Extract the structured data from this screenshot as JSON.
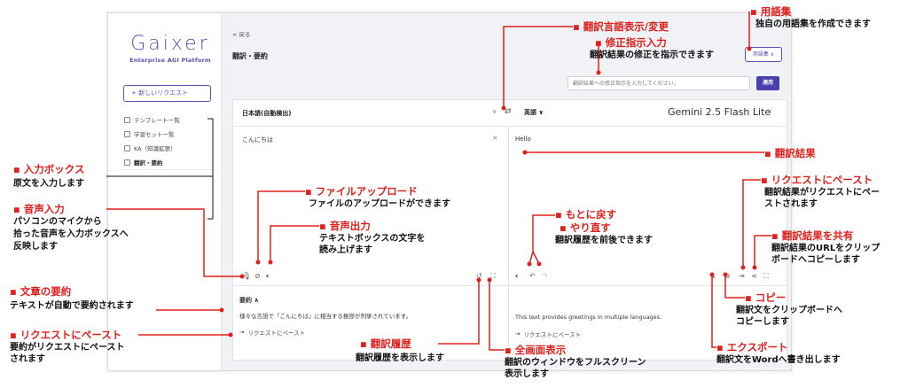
{
  "app": {
    "logo": "Gaixer",
    "logo_sub": "Enterprise AGI Platform",
    "new_request": "+ 新しいリクエスト",
    "nav": [
      "テンプレート一覧",
      "学習セット一覧",
      "KA（知識拡張）",
      "翻訳・要約"
    ],
    "back": "< 戻る",
    "page_title": "翻訳・要約",
    "glossary_button": "用語集 ∨",
    "instruction_placeholder": "翻訳結果への修正指示を入力してください。",
    "apply_button": "適用",
    "source_lang": "日本語(自動検出)",
    "target_lang": "英語 ∨",
    "model": "Gemini 2.5 Flash Lite",
    "source_text": "こんにちは",
    "target_text": "Hello",
    "summary_header": "要約 ∧",
    "summary_text": "様々な言語で「こんにちは」に相当する挨拶が列挙されています。",
    "summary_paste": "リクエストにペースト",
    "translated_summary_text": "This text provides greetings in multiple languages.",
    "translated_summary_paste": "リクエストにペースト"
  },
  "annotations": {
    "glossary_title": "▪ 用語集",
    "glossary_desc": "独自の用語集を作成できます",
    "lang_title": "▪ 翻訳言語表示/変更",
    "fix_title": "▪ 修正指示入力",
    "fix_desc": "翻訳結果の修正を指示できます",
    "result_title": "▪ 翻訳結果",
    "paste_req_title": "▪ リクエストにペースト",
    "paste_req_desc1": "翻訳結果がリクエストにペー",
    "paste_req_desc2": "ストされます",
    "share_title": "▪ 翻訳結果を共有",
    "share_desc1": "翻訳結果のURLをクリップ",
    "share_desc2": "ボードへコピーします",
    "copy_title": "▪ コピー",
    "copy_desc1": "翻訳文をクリップボードへ",
    "copy_desc2": "コピーします",
    "export_title": "▪ エクスポート",
    "export_desc": "翻訳文をWordへ書き出します",
    "fullscreen_title": "▪ 全画面表示",
    "fullscreen_desc1": "翻訳のウィンドウをフルスクリーン",
    "fullscreen_desc2": "表示します",
    "history_title": "▪ 翻訳履歴",
    "history_desc": "翻訳履歴を表示します",
    "undo_title": "▪ もとに戻す",
    "redo_title": "▪ やり直す",
    "undo_desc": "翻訳履歴を前後できます",
    "file_title": "▪ ファイルアップロード",
    "file_desc": "ファイルのアップロードができます",
    "speech_out_title": "▪ 音声出力",
    "speech_out_desc1": "テキストボックスの文字を",
    "speech_out_desc2": "読み上げます",
    "input_box_title": "▪ 入力ボックス",
    "input_box_desc": "原文を入力します",
    "voice_title": "▪ 音声入力",
    "voice_desc1": "パソコンのマイクから",
    "voice_desc2": "拾った音声を入力ボックスへ",
    "voice_desc3": "反映します",
    "summary_title": "▪ 文章の要約",
    "summary_desc": "テキストが自動で要約されます",
    "sum_paste_title": "▪ リクエストにペースト",
    "sum_paste_desc1": "要約がリクエストにペースト",
    "sum_paste_desc2": "されます"
  }
}
